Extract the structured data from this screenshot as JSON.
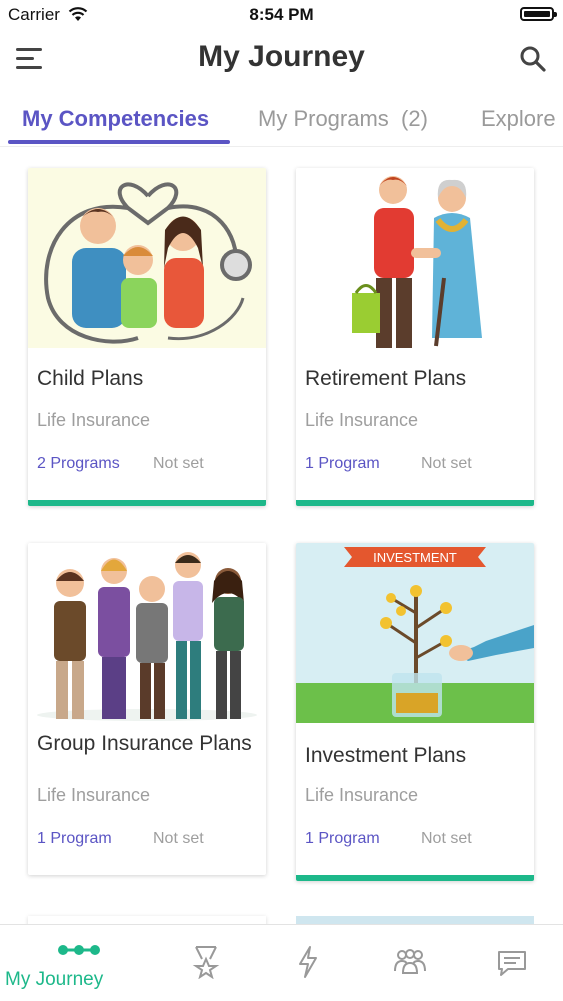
{
  "status_bar": {
    "carrier": "Carrier",
    "time": "8:54 PM"
  },
  "header": {
    "title": "My Journey"
  },
  "tabs": [
    {
      "label": "My Competencies",
      "active": true
    },
    {
      "label": "My Programs  (2)",
      "active": false
    },
    {
      "label": "Explore",
      "active": false
    }
  ],
  "cards": [
    {
      "title": "Child Plans",
      "category": "Life Insurance",
      "programs": "2 Programs",
      "status": "Not set",
      "image": "family-stethoscope-illustration",
      "progress": 1
    },
    {
      "title": "Retirement Plans",
      "category": "Life Insurance",
      "programs": "1 Program",
      "status": "Not set",
      "image": "elderly-couple-illustration",
      "progress": 1
    },
    {
      "title": "Group Insurance Plans",
      "category": "Life Insurance",
      "programs": "1 Program",
      "status": "Not set",
      "image": "group-of-people-illustration",
      "progress": 0
    },
    {
      "title": "Investment Plans",
      "category": "Life Insurance",
      "programs": "1 Program",
      "status": "Not set",
      "image": "investment-plant-illustration",
      "image_banner": "INVESTMENT",
      "progress": 1
    }
  ],
  "bottom_nav": [
    {
      "label": "My Journey",
      "icon": "journey-dots-icon",
      "active": true
    },
    {
      "label": "",
      "icon": "medal-icon"
    },
    {
      "label": "",
      "icon": "lightning-icon"
    },
    {
      "label": "",
      "icon": "community-icon"
    },
    {
      "label": "",
      "icon": "chat-icon"
    }
  ],
  "colors": {
    "accent": "#5b55c4",
    "progress": "#1db88a",
    "nav_active": "#1db88a"
  }
}
